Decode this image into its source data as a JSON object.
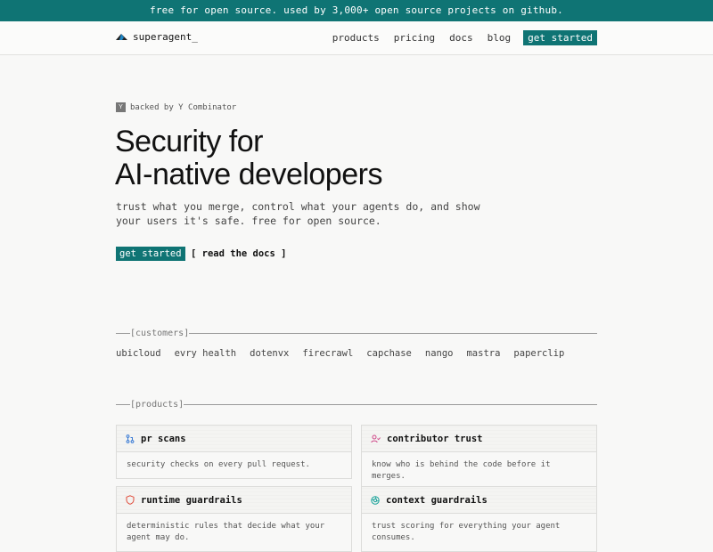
{
  "banner": {
    "text": "free for open source. used by 3,000+ open source projects on github."
  },
  "header": {
    "brand": "superagent_",
    "nav": {
      "products": "products",
      "pricing": "pricing",
      "docs": "docs",
      "blog": "blog",
      "cta": "get started"
    }
  },
  "hero": {
    "yc_badge": "Y",
    "yc_text": "backed by Y Combinator",
    "title_line1": "Security for",
    "title_line2": "AI-native developers",
    "subtitle": "trust what you merge, control what your agents do, and show your users it's safe. free for open source.",
    "cta_primary": "get started",
    "cta_secondary": "[ read the docs ]"
  },
  "customers": {
    "label": "[customers]",
    "items": [
      "ubicloud",
      "evry health",
      "dotenvx",
      "firecrawl",
      "capchase",
      "nango",
      "mastra",
      "paperclip"
    ]
  },
  "products": {
    "label": "[products]",
    "cards": [
      {
        "title": "pr scans",
        "icon": "git-pull-request-icon",
        "description": "security checks on every pull request."
      },
      {
        "title": "contributor trust",
        "icon": "user-check-icon",
        "description": "know who is behind the code before it merges."
      },
      {
        "title": "runtime guardrails",
        "icon": "shield-icon",
        "description": "deterministic rules that decide what your agent may do."
      },
      {
        "title": "context guardrails",
        "icon": "aperture-icon",
        "description": "trust scoring for everything your agent consumes."
      }
    ]
  },
  "colors": {
    "accent": "#0f7474",
    "background": "#f8f8f7",
    "icon_accent": "#e04b3a",
    "icon_blue": "#3a7bd5"
  }
}
